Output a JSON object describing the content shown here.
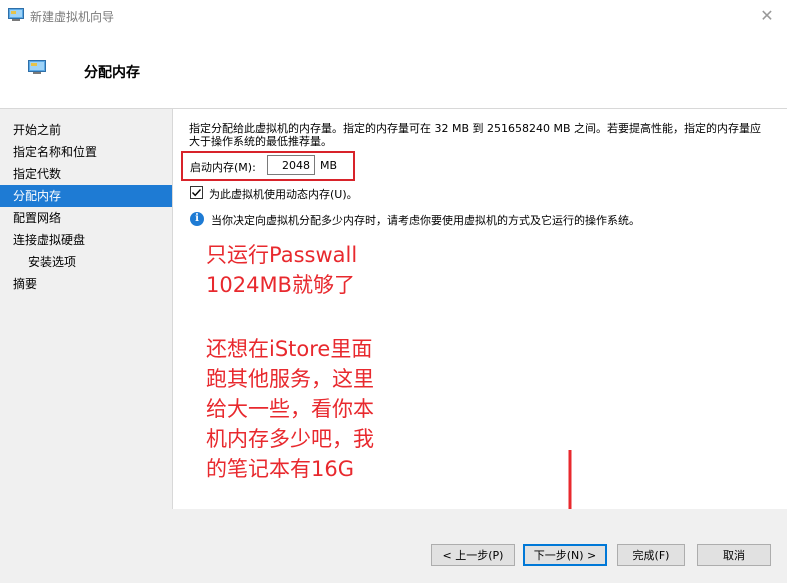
{
  "window": {
    "title": "新建虚拟机向导",
    "close_glyph": "✕"
  },
  "header": {
    "title": "分配内存"
  },
  "sidebar": {
    "items": [
      {
        "label": "开始之前"
      },
      {
        "label": "指定名称和位置"
      },
      {
        "label": "指定代数"
      },
      {
        "label": "分配内存"
      },
      {
        "label": "配置网络"
      },
      {
        "label": "连接虚拟硬盘"
      },
      {
        "label": "安装选项"
      },
      {
        "label": "摘要"
      }
    ],
    "active_index": 3
  },
  "main": {
    "description": "指定分配给此虚拟机的内存量。指定的内存量可在 32 MB 到 251658240 MB 之间。若要提高性能，指定的内存量应大于操作系统的最低推荐量。",
    "startup_memory_label": "启动内存(M):",
    "startup_memory_value": "2048",
    "memory_unit": "MB",
    "dynamic_memory_label": "为此虚拟机使用动态内存(U)。",
    "dynamic_memory_checked": true,
    "info_text": "当你决定向虚拟机分配多少内存时，请考虑你要使用虚拟机的方式及它运行的操作系统。"
  },
  "annotation": {
    "line1": "只运行Passwall",
    "line2": "1024MB就够了",
    "line3": "还想在iStore里面",
    "line4": "跑其他服务，这里",
    "line5": "给大一些，看你本",
    "line6": "机内存多少吧，我",
    "line7": "的笔记本有16G",
    "color": "#e8292e"
  },
  "footer": {
    "prev_label": "< 上一步(P)",
    "next_label": "下一步(N) >",
    "finish_label": "完成(F)",
    "cancel_label": "取消"
  },
  "colors": {
    "accent": "#1e7bd4",
    "highlight_box": "#d8232a"
  }
}
